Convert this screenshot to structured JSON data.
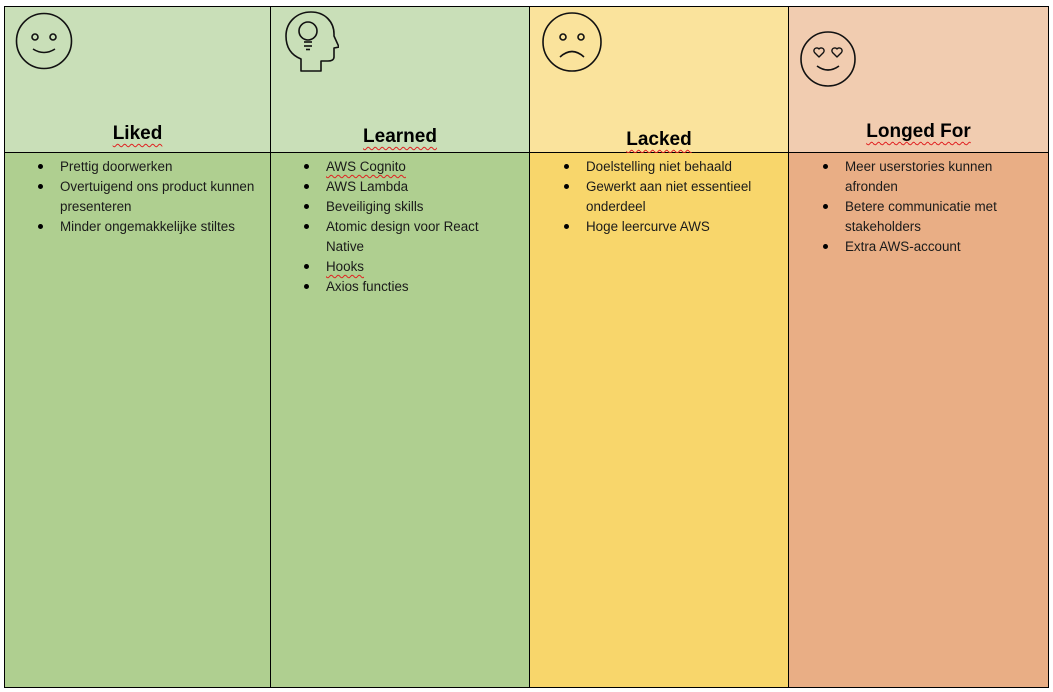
{
  "columns": [
    {
      "title": "Liked",
      "icon": "smiley-face-icon",
      "header_color": "#c9dfb8",
      "body_color": "#afcf90",
      "items": [
        [
          "Prettig doorwerken"
        ],
        [
          "Overtuigend ons product kunnen",
          "presenteren"
        ],
        [
          "Minder ongemakkelijke stiltes"
        ]
      ]
    },
    {
      "title": "Learned",
      "icon": "lightbulb-head-icon",
      "header_color": "#c9dfb8",
      "body_color": "#afcf90",
      "items": [
        [
          "AWS Cognito"
        ],
        [
          "AWS Lambda"
        ],
        [
          "Beveiliging skills"
        ],
        [
          "Atomic design voor React",
          "Native"
        ],
        [
          "Hooks"
        ],
        [
          "Axios functies"
        ]
      ]
    },
    {
      "title": "Lacked",
      "icon": "sad-face-icon",
      "header_color": "#fae39c",
      "body_color": "#f8d66b",
      "items": [
        [
          "Doelstelling niet behaald"
        ],
        [
          "Gewerkt aan niet essentieel",
          "onderdeel"
        ],
        [
          "Hoge leercurve AWS"
        ]
      ]
    },
    {
      "title": "Longed For",
      "icon": "heart-eyes-face-icon",
      "header_color": "#f1ccb0",
      "body_color": "#e9ae85",
      "items": [
        [
          "Meer userstories kunnen",
          "afronden"
        ],
        [
          "Betere communicatie met",
          "stakeholders"
        ],
        [
          "Extra AWS-account"
        ]
      ]
    }
  ]
}
